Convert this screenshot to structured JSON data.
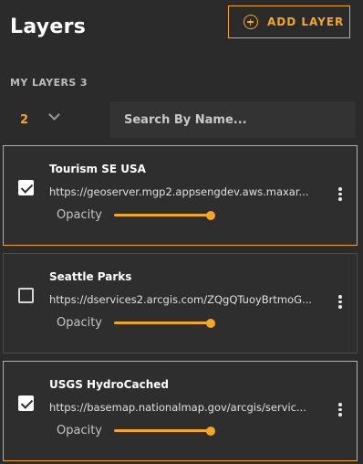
{
  "header": {
    "title": "Layers",
    "add_layer_label": "ADD LAYER",
    "add_icon": "plus-circle-icon"
  },
  "section": {
    "label": "MY LAYERS 3",
    "count": "2",
    "search_placeholder": "Search By Name...",
    "search_value": ""
  },
  "colors": {
    "accent": "#f5a623",
    "background": "#2b2b2b",
    "card": "#2e2e2e"
  },
  "layers": [
    {
      "name": "Tourism SE USA",
      "url": "https://geoserver.mgp2.appsengdev.aws.maxar.com/geoserver/wms",
      "url_display": "https://geoserver.mgp2.appsengdev.aws.maxar...",
      "checked": true,
      "selected": true,
      "opacity_label": "Opacity",
      "opacity": 1.0
    },
    {
      "name": "Seattle Parks",
      "url": "https://dservices2.arcgis.com/ZQgQTuoyBrtmoGdP/arcgis/rest/services",
      "url_display": "https://dservices2.arcgis.com/ZQgQTuoyBrtmoG...",
      "checked": false,
      "selected": false,
      "opacity_label": "Opacity",
      "opacity": 1.0
    },
    {
      "name": "USGS HydroCached",
      "url": "https://basemap.nationalmap.gov/arcgis/services/USGSHydroCached",
      "url_display": "https://basemap.nationalmap.gov/arcgis/servic...",
      "checked": true,
      "selected": true,
      "opacity_label": "Opacity",
      "opacity": 1.0
    }
  ]
}
